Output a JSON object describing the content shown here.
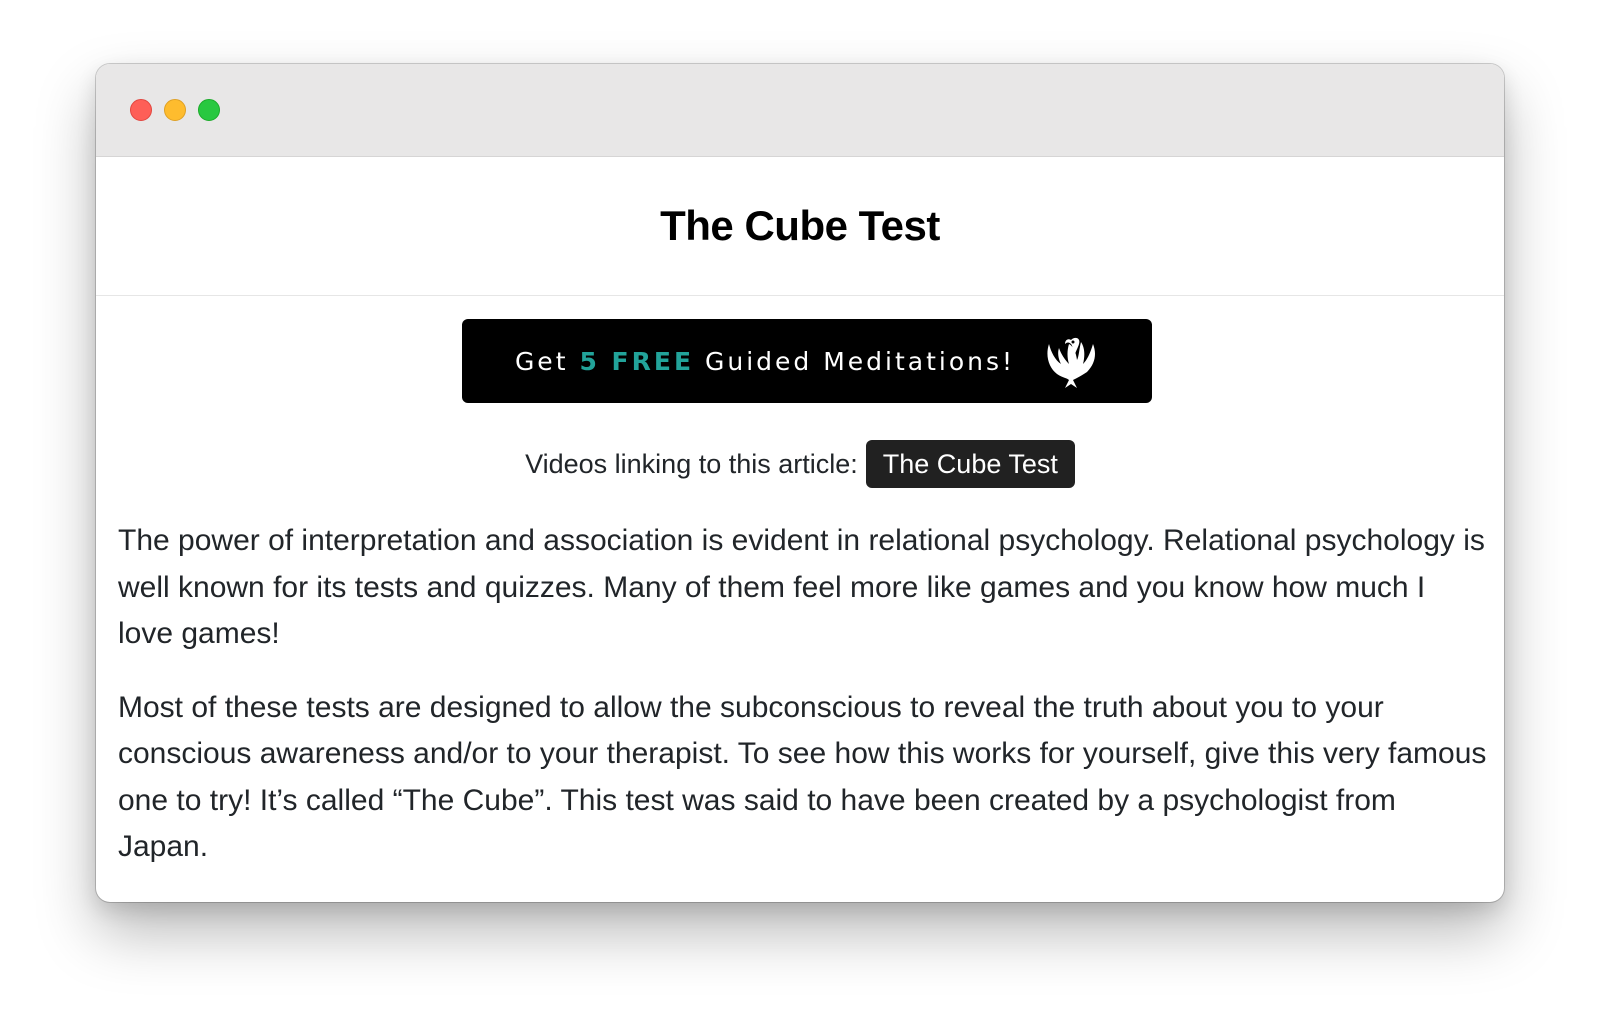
{
  "window": {
    "controls": [
      "close",
      "minimize",
      "zoom"
    ]
  },
  "header": {
    "title": "The Cube Test"
  },
  "banner": {
    "text_before": "Get ",
    "highlight": "5 FREE",
    "text_after": " Guided Meditations!",
    "highlight_color": "#22a39a",
    "icon": "swan-icon"
  },
  "videos": {
    "label": "Videos linking to this article:",
    "tags": [
      "The Cube Test"
    ]
  },
  "article": {
    "paragraphs": [
      "The power of interpretation and association is evident in relational psychology. Relational psychology is well known for its tests and quizzes. Many of them feel more like games and you know how much I love games!",
      "Most of these tests are designed to allow the subconscious to reveal the truth about you to your conscious awareness and/or to your therapist. To see how this works for yourself, give this very famous one to try! It’s called “The Cube”. This test was said to have been created by a psychologist from Japan."
    ]
  }
}
